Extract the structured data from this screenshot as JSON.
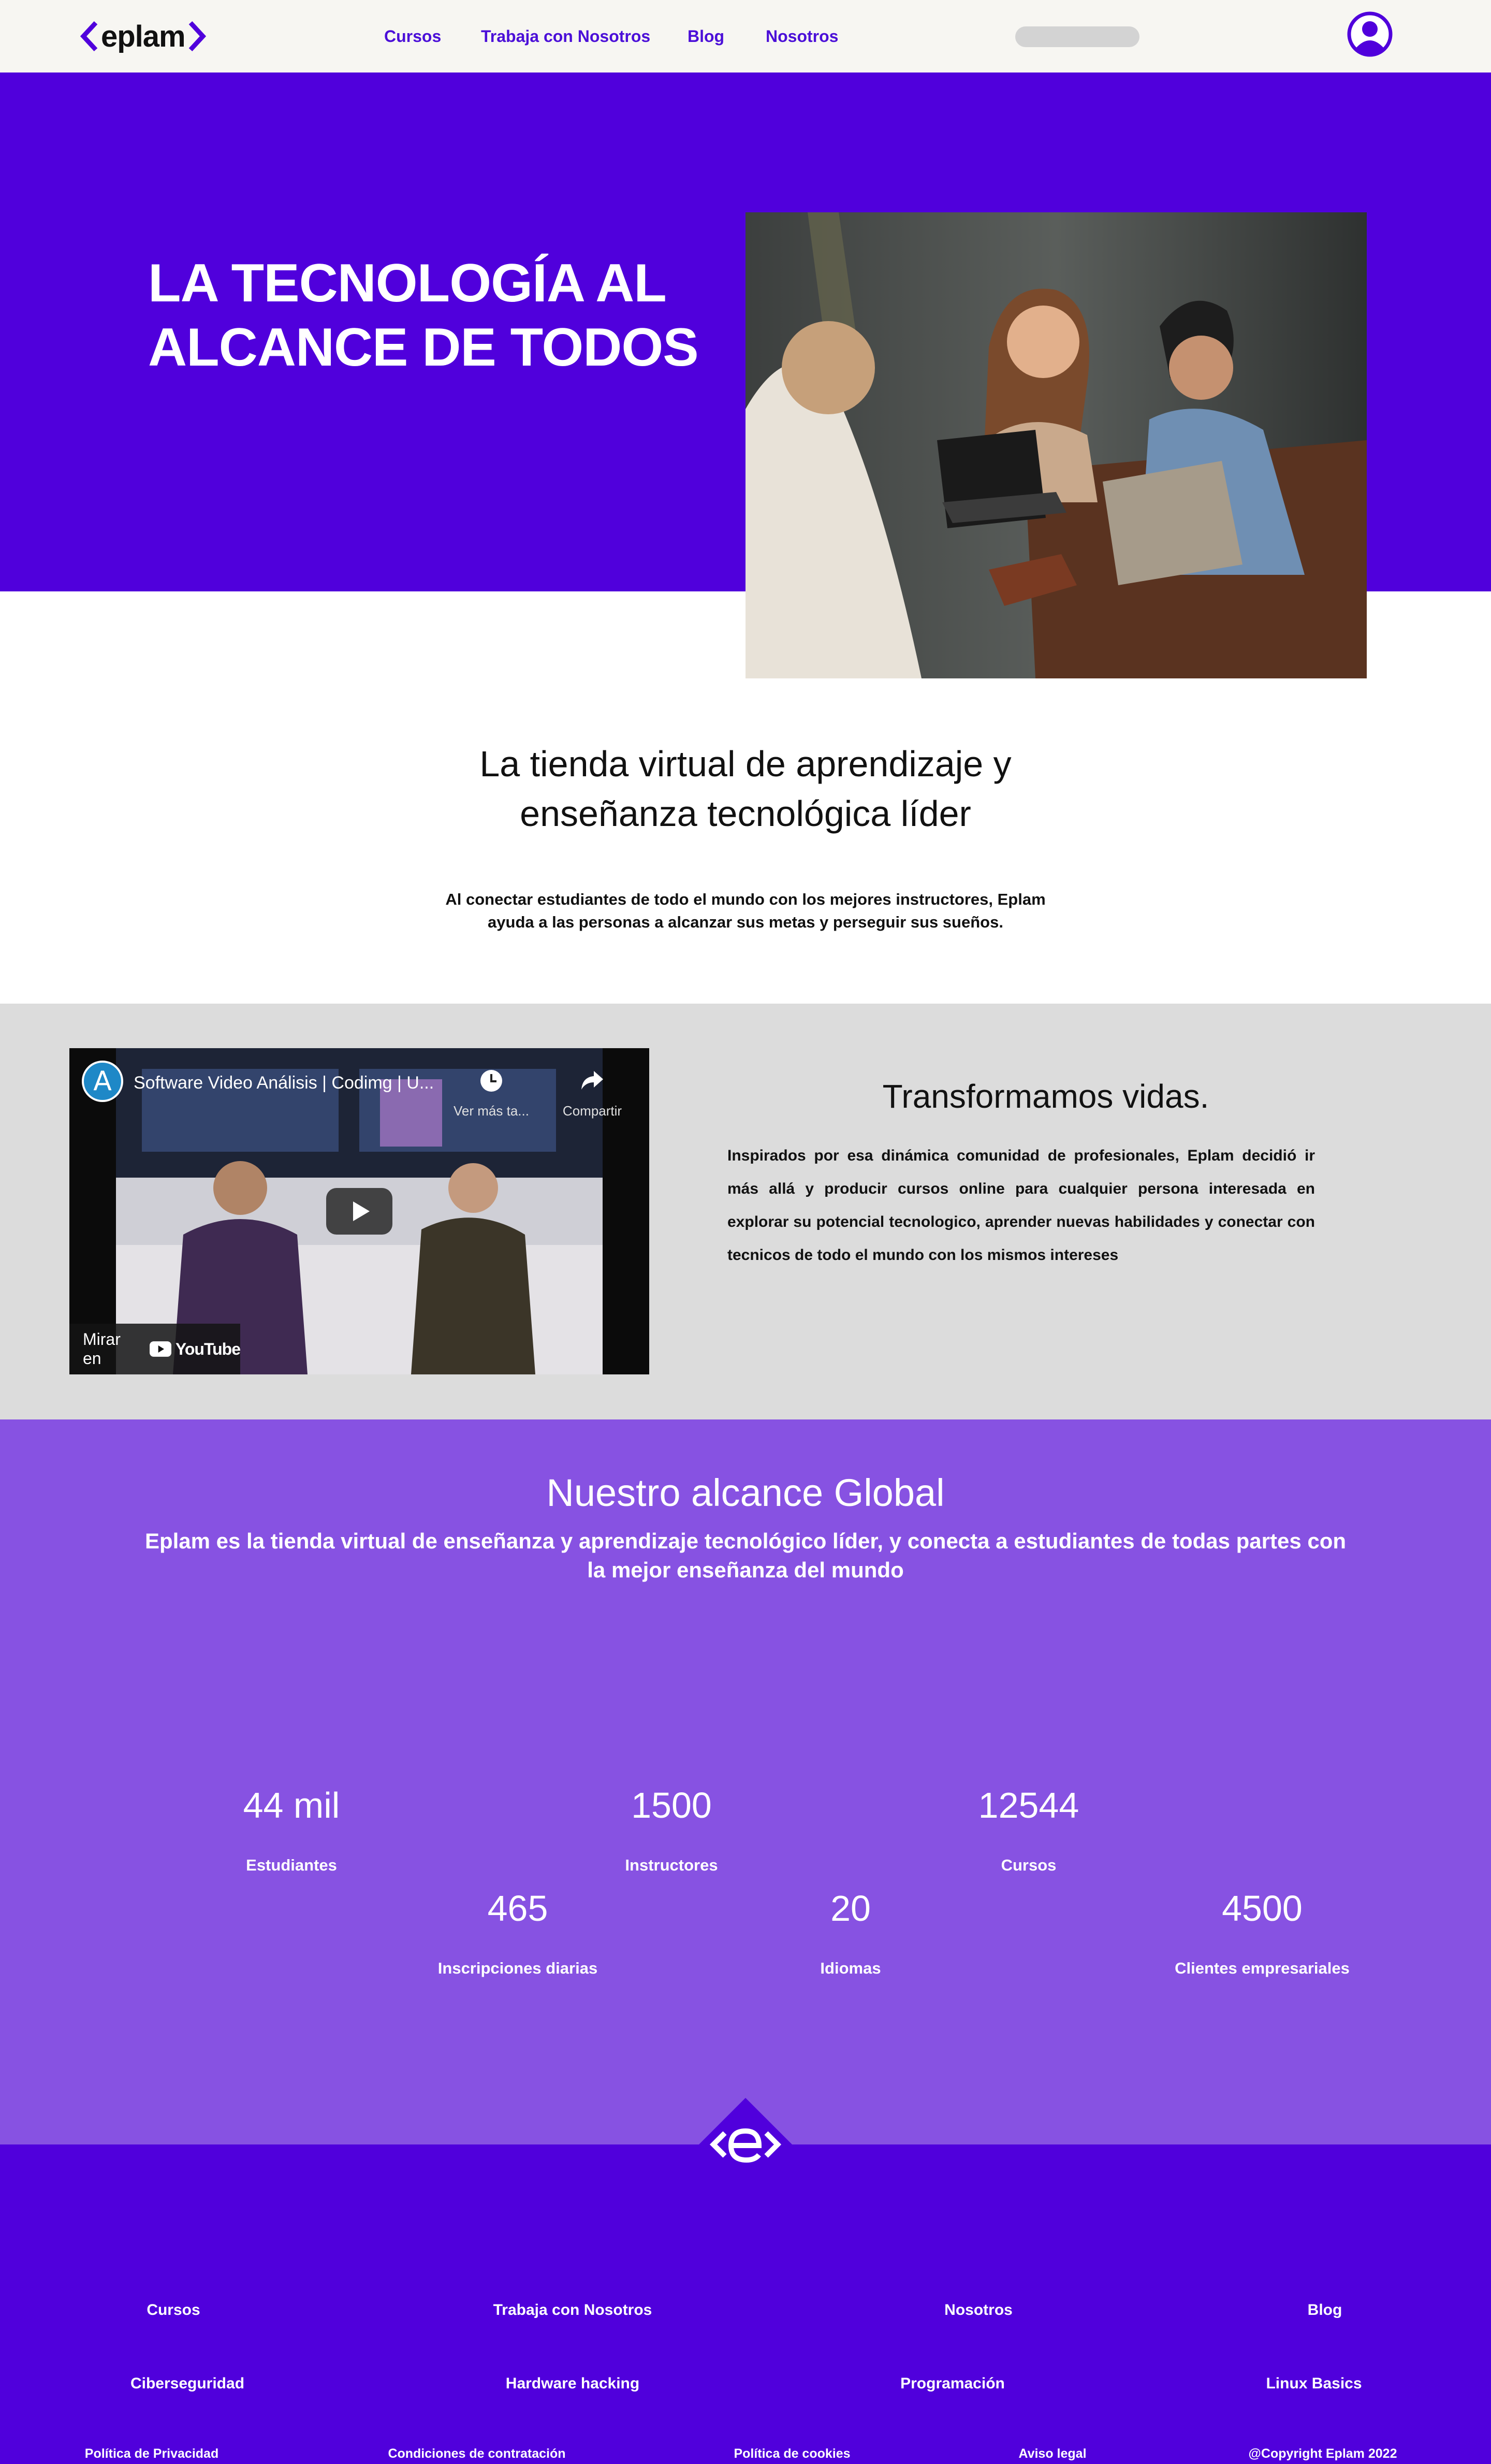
{
  "nav": {
    "logo_text": "eplam",
    "links": [
      {
        "label": "Cursos"
      },
      {
        "label": "Trabaja con Nosotros"
      },
      {
        "label": "Blog"
      },
      {
        "label": "Nosotros"
      }
    ],
    "search_placeholder": ""
  },
  "hero": {
    "title_line1": "LA TECNOLOGÍA AL",
    "title_line2": "ALCANCE DE TODOS"
  },
  "intro": {
    "heading_line1": "La tienda virtual de aprendizaje y",
    "heading_line2": "enseñanza tecnológica líder",
    "text_line1": "Al conectar estudiantes de todo el mundo con los mejores instructores, Eplam",
    "text_line2": "ayuda a las personas a alcanzar sus metas y perseguir sus sueños."
  },
  "video": {
    "channel_letter": "A",
    "title": "Software Video Análisis | Codimg | U...",
    "watch_later": "Ver más ta...",
    "share": "Compartir",
    "watch_on": "Mirar en",
    "youtube": "YouTube"
  },
  "transform": {
    "heading": "Transformamos vidas.",
    "text": "Inspirados por esa dinámica comunidad de profesionales, Eplam decidió ir más allá y producir cursos online para cualquier persona interesada en explorar su potencial tecnologico, aprender nuevas habilidades y conectar con tecnicos de todo el mundo con los mismos intereses"
  },
  "reach": {
    "heading": "Nuestro alcance Global",
    "subheading": "Eplam es la tienda virtual de enseñanza y aprendizaje tecnológico líder, y conecta a estudiantes de todas partes con la mejor enseñanza del mundo",
    "stats": [
      {
        "value": "44 mil",
        "label": "Estudiantes"
      },
      {
        "value": "1500",
        "label": "Instructores"
      },
      {
        "value": "12544",
        "label": "Cursos"
      },
      {
        "value": "465",
        "label": "Inscripciones diarias"
      },
      {
        "value": "20",
        "label": "Idiomas"
      },
      {
        "value": "4500",
        "label": "Clientes empresariales"
      }
    ]
  },
  "footer": {
    "nav_links": [
      {
        "label": "Cursos"
      },
      {
        "label": "Trabaja con Nosotros"
      },
      {
        "label": "Nosotros"
      },
      {
        "label": "Blog"
      }
    ],
    "course_links": [
      {
        "label": "Ciberseguridad"
      },
      {
        "label": "Hardware hacking"
      },
      {
        "label": "Programación"
      },
      {
        "label": "Linux Basics"
      }
    ],
    "legal_links": [
      {
        "label": "Política de Privacidad"
      },
      {
        "label": "Condiciones de contratación"
      },
      {
        "label": "Política de cookies"
      },
      {
        "label": "Aviso legal"
      }
    ],
    "copyright": "@Copyright Eplam 2022"
  },
  "colors": {
    "brand_purple": "#5000dc",
    "reach_purple": "#8752e2",
    "grey_band": "#dcdcdc",
    "nav_bg": "#f7f6f2"
  }
}
